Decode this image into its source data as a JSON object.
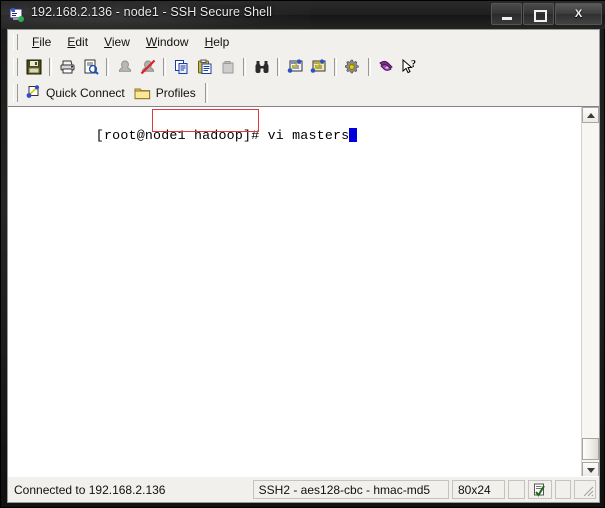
{
  "window": {
    "title": "192.168.2.136 - node1 - SSH Secure Shell",
    "app_icon": "ssh-terminal-icon",
    "controls": {
      "minimize": "minimize-button",
      "maximize": "maximize-button",
      "close_label": "X"
    }
  },
  "menubar": {
    "items": [
      {
        "pre": "",
        "accel": "F",
        "post": "ile"
      },
      {
        "pre": "",
        "accel": "E",
        "post": "dit"
      },
      {
        "pre": "",
        "accel": "V",
        "post": "iew"
      },
      {
        "pre": "",
        "accel": "W",
        "post": "indow"
      },
      {
        "pre": "",
        "accel": "H",
        "post": "elp"
      }
    ]
  },
  "toolbar": {
    "buttons": [
      {
        "name": "save-button",
        "icon": "floppy-disk-icon",
        "enabled": true
      },
      {
        "name": "print-button",
        "icon": "printer-icon",
        "enabled": true
      },
      {
        "name": "print-preview-button",
        "icon": "print-preview-icon",
        "enabled": true
      },
      {
        "name": "connect-button",
        "icon": "connect-person-icon",
        "enabled": false
      },
      {
        "name": "disconnect-button",
        "icon": "disconnect-person-icon",
        "enabled": true
      },
      {
        "name": "copy-button",
        "icon": "copy-pages-icon",
        "enabled": true
      },
      {
        "name": "paste-button",
        "icon": "clipboard-paste-icon",
        "enabled": true
      },
      {
        "name": "cut-button",
        "icon": "clipboard-empty-icon",
        "enabled": false
      },
      {
        "name": "find-button",
        "icon": "binoculars-icon",
        "enabled": true
      },
      {
        "name": "new-terminal-button",
        "icon": "terminal-window-icon",
        "enabled": true
      },
      {
        "name": "file-transfer-button",
        "icon": "file-transfer-window-icon",
        "enabled": true
      },
      {
        "name": "settings-button",
        "icon": "gear-settings-icon",
        "enabled": true
      },
      {
        "name": "help-button",
        "icon": "purple-book-icon",
        "enabled": true
      },
      {
        "name": "context-help-button",
        "icon": "arrow-question-icon",
        "enabled": true
      }
    ]
  },
  "quickbar": {
    "quick_connect": "Quick Connect",
    "quick_connect_icon": "connect-plug-icon",
    "profiles": "Profiles",
    "profiles_icon": "folder-icon"
  },
  "terminal": {
    "prompt": "[root@node1 hadoop]# vi masters",
    "cursor": "block-cursor",
    "cursor_color": "#0000dd",
    "annotation": {
      "type": "red-rectangle-highlight",
      "color": "#e03a3a",
      "covers": "# vi masters"
    }
  },
  "scrollbar": {
    "up_arrow": "scroll-up-arrow",
    "down_arrow": "scroll-down-arrow",
    "thumb": "scroll-thumb"
  },
  "statusbar": {
    "connection": "Connected to 192.168.2.136",
    "cipher": "SSH2 - aes128-cbc - hmac-md5",
    "size": "80x24",
    "indicator_icon": "capture-log-icon",
    "resize_grip": "resize-grip"
  }
}
